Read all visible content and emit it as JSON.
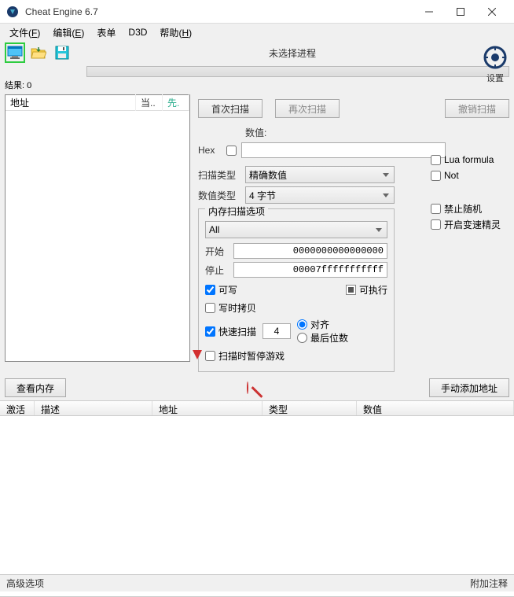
{
  "titlebar": {
    "title": "Cheat Engine 6.7"
  },
  "menu": {
    "file": "文件",
    "file_u": "F",
    "edit": "编辑",
    "edit_u": "E",
    "table": "表单",
    "d3d": "D3D",
    "help": "帮助",
    "help_u": "H"
  },
  "toolbar": {
    "process_label": "未选择进程",
    "results_label": "结果: 0",
    "settings_label": "设置"
  },
  "left_list": {
    "col_address": "地址",
    "col_current": "当..",
    "col_previous": "先."
  },
  "scan": {
    "first_scan": "首次扫描",
    "next_scan": "再次扫描",
    "undo_scan": "撤销扫描",
    "value_label": "数值:",
    "hex_label": "Hex",
    "scan_type_label": "扫描类型",
    "scan_type_value": "精确数值",
    "value_type_label": "数值类型",
    "value_type_value": "4 字节",
    "lua_formula": "Lua formula",
    "not_label": "Not",
    "disable_random": "禁止随机",
    "enable_speedhack": "开启变速精灵"
  },
  "mem_options": {
    "legend": "内存扫描选项",
    "all": "All",
    "start_label": "开始",
    "start_value": "0000000000000000",
    "stop_label": "停止",
    "stop_value": "00007fffffffffff",
    "writable": "可写",
    "executable": "可执行",
    "copy_on_write": "写时拷贝",
    "fast_scan": "快速扫描",
    "fast_scan_value": "4",
    "aligned": "对齐",
    "last_digits": "最后位数",
    "pause_game": "扫描时暂停游戏"
  },
  "buttons": {
    "view_memory": "查看内存",
    "add_manual": "手动添加地址"
  },
  "table": {
    "active": "激活",
    "description": "描述",
    "address": "地址",
    "type": "类型",
    "value": "数值"
  },
  "bottom": {
    "advanced": "高级选项",
    "comment": "附加注释"
  }
}
